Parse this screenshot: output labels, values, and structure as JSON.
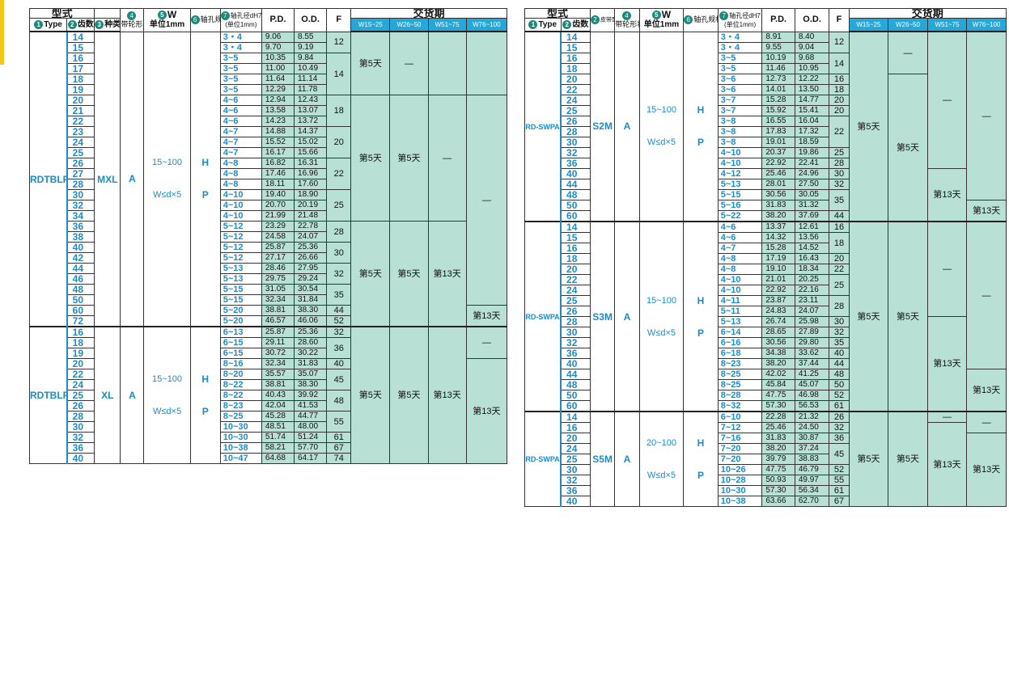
{
  "header": {
    "type_group": "型式",
    "type_label": "Type",
    "teeth_label": "齿数",
    "kind_label": "种类",
    "belt_shape": "带轮形状",
    "w_label": "W",
    "w_unit": "单位1mm",
    "shaft_spec": "轴孔规格",
    "bore_dia": "轴孔径dH7",
    "bore_unit": "(单位1mm)",
    "pd": "P.D.",
    "od": "O.D.",
    "f": "F",
    "delivery": "交货期",
    "w1": "W15~25",
    "w2": "W26~50",
    "w3": "W51~75",
    "w4": "W76~100",
    "n1": "1",
    "n2": "2",
    "n3": "3",
    "n4": "4",
    "n5": "5",
    "n6": "6",
    "n7": "7",
    "belt_type_short": "皮带型号"
  },
  "left": {
    "sections": [
      {
        "type": "RDTBLRZB",
        "kind": "MXL",
        "shape": "A",
        "w_range": "15~100",
        "w_cond": "W≤d×5",
        "h": "H",
        "p": "P",
        "rows": [
          [
            "14",
            "3・4",
            "9.06",
            "8.55"
          ],
          [
            "15",
            "3・4",
            "9.70",
            "9.19"
          ],
          [
            "16",
            "3~5",
            "10.35",
            "9.84"
          ],
          [
            "17",
            "3~5",
            "11.00",
            "10.49"
          ],
          [
            "18",
            "3~5",
            "11.64",
            "11.14"
          ],
          [
            "19",
            "3~5",
            "12.29",
            "11.78"
          ],
          [
            "20",
            "4~6",
            "12.94",
            "12.43"
          ],
          [
            "21",
            "4~6",
            "13.58",
            "13.07"
          ],
          [
            "22",
            "4~6",
            "14.23",
            "13.72"
          ],
          [
            "23",
            "4~7",
            "14.88",
            "14.37"
          ],
          [
            "24",
            "4~7",
            "15.52",
            "15.02"
          ],
          [
            "25",
            "4~7",
            "16.17",
            "15.66"
          ],
          [
            "26",
            "4~8",
            "16.82",
            "16.31"
          ],
          [
            "27",
            "4~8",
            "17.46",
            "16.96"
          ],
          [
            "28",
            "4~8",
            "18.11",
            "17.60"
          ],
          [
            "30",
            "4~10",
            "19.40",
            "18.90"
          ],
          [
            "32",
            "4~10",
            "20.70",
            "20.19"
          ],
          [
            "34",
            "4~10",
            "21.99",
            "21.48"
          ],
          [
            "36",
            "5~12",
            "23.29",
            "22.78"
          ],
          [
            "38",
            "5~12",
            "24.58",
            "24.07"
          ],
          [
            "40",
            "5~12",
            "25.87",
            "25.36"
          ],
          [
            "42",
            "5~12",
            "27.17",
            "26.66"
          ],
          [
            "44",
            "5~13",
            "28.46",
            "27.95"
          ],
          [
            "46",
            "5~13",
            "29.75",
            "29.24"
          ],
          [
            "48",
            "5~15",
            "31.05",
            "30.54"
          ],
          [
            "50",
            "5~15",
            "32.34",
            "31.84"
          ],
          [
            "60",
            "5~20",
            "38.81",
            "38.30"
          ],
          [
            "72",
            "5~20",
            "46.57",
            "46.06"
          ]
        ],
        "f": [
          [
            "12",
            2
          ],
          [
            "14",
            4
          ],
          [
            "18",
            3
          ],
          [
            "20",
            3
          ],
          [
            "22",
            3
          ],
          [
            "25",
            3
          ],
          [
            "28",
            2
          ],
          [
            "30",
            2
          ],
          [
            "32",
            2
          ],
          [
            "35",
            2
          ],
          [
            "44",
            1
          ],
          [
            "52",
            1
          ]
        ],
        "d1": [
          [
            "第5天",
            6
          ],
          [
            "第5天",
            12
          ],
          [
            "第5天",
            10
          ]
        ],
        "d2": [
          [
            "—",
            6
          ],
          [
            "第5天",
            12
          ],
          [
            "第5天",
            10
          ]
        ],
        "d3": [
          [
            "",
            6
          ],
          [
            "—",
            12
          ],
          [
            "第13天",
            10
          ]
        ],
        "d4": [
          [
            "",
            6
          ],
          [
            "—",
            20
          ],
          [
            "第13天",
            2
          ]
        ]
      },
      {
        "type": "RDTBLRZB",
        "kind": "XL",
        "shape": "A",
        "w_range": "15~100",
        "w_cond": "W≤d×5",
        "h": "H",
        "p": "P",
        "rows": [
          [
            "16",
            "6~13",
            "25.87",
            "25.36"
          ],
          [
            "18",
            "6~15",
            "29.11",
            "28.60"
          ],
          [
            "19",
            "6~15",
            "30.72",
            "30.22"
          ],
          [
            "20",
            "8~16",
            "32.34",
            "31.83"
          ],
          [
            "22",
            "8~20",
            "35.57",
            "35.07"
          ],
          [
            "24",
            "8~22",
            "38.81",
            "38.30"
          ],
          [
            "25",
            "8~22",
            "40.43",
            "39.92"
          ],
          [
            "26",
            "8~23",
            "42.04",
            "41.53"
          ],
          [
            "28",
            "8~25",
            "45.28",
            "44.77"
          ],
          [
            "30",
            "10~30",
            "48.51",
            "48.00"
          ],
          [
            "32",
            "10~30",
            "51.74",
            "51.24"
          ],
          [
            "36",
            "10~38",
            "58.21",
            "57.70"
          ],
          [
            "40",
            "10~47",
            "64.68",
            "64.17"
          ]
        ],
        "f": [
          [
            "32",
            1
          ],
          [
            "36",
            2
          ],
          [
            "40",
            1
          ],
          [
            "45",
            2
          ],
          [
            "48",
            2
          ],
          [
            "55",
            2
          ],
          [
            "61",
            1
          ],
          [
            "67",
            1
          ],
          [
            "74",
            1
          ]
        ],
        "d1": [
          [
            "第5天",
            13
          ]
        ],
        "d2": [
          [
            "第5天",
            13
          ]
        ],
        "d3": [
          [
            "第13天",
            13
          ]
        ],
        "d4": [
          [
            "—",
            3
          ],
          [
            "第13天",
            10
          ]
        ]
      }
    ]
  },
  "right": {
    "sections": [
      {
        "type": "RD-SWPA",
        "kind": "S2M",
        "shape": "A",
        "w_range": "15~100",
        "w_cond": "W≤d×5",
        "h": "H",
        "p": "P",
        "rows": [
          [
            "14",
            "3・4",
            "8.91",
            "8.40"
          ],
          [
            "15",
            "3・4",
            "9.55",
            "9.04"
          ],
          [
            "16",
            "3~5",
            "10.19",
            "9.68"
          ],
          [
            "18",
            "3~5",
            "11.46",
            "10.95"
          ],
          [
            "20",
            "3~6",
            "12.73",
            "12.22"
          ],
          [
            "22",
            "3~6",
            "14.01",
            "13.50"
          ],
          [
            "24",
            "3~7",
            "15.28",
            "14.77"
          ],
          [
            "25",
            "3~7",
            "15.92",
            "15.41"
          ],
          [
            "26",
            "3~8",
            "16.55",
            "16.04"
          ],
          [
            "28",
            "3~8",
            "17.83",
            "17.32"
          ],
          [
            "30",
            "3~8",
            "19.01",
            "18.59"
          ],
          [
            "32",
            "4~10",
            "20.37",
            "19.86"
          ],
          [
            "36",
            "4~10",
            "22.92",
            "22.41"
          ],
          [
            "40",
            "4~12",
            "25.46",
            "24.96"
          ],
          [
            "44",
            "5~13",
            "28.01",
            "27.50"
          ],
          [
            "48",
            "5~15",
            "30.56",
            "30.05"
          ],
          [
            "50",
            "5~16",
            "31.83",
            "31.32"
          ],
          [
            "60",
            "5~22",
            "38.20",
            "37.69"
          ]
        ],
        "f": [
          [
            "12",
            2
          ],
          [
            "14",
            2
          ],
          [
            "16",
            1
          ],
          [
            "18",
            1
          ],
          [
            "20",
            1
          ],
          [
            "20",
            1
          ],
          [
            "22",
            3
          ],
          [
            "25",
            1
          ],
          [
            "28",
            1
          ],
          [
            "30",
            1
          ],
          [
            "32",
            1
          ],
          [
            "35",
            2
          ],
          [
            "44",
            1
          ]
        ],
        "d1": [
          [
            "第5天",
            18
          ]
        ],
        "d2": [
          [
            "—",
            4
          ],
          [
            "第5天",
            14
          ]
        ],
        "d3": [
          [
            "—",
            13
          ],
          [
            "第13天",
            5
          ]
        ],
        "d4": [
          [
            "—",
            16
          ],
          [
            "第13天",
            2
          ]
        ]
      },
      {
        "type": "RD-SWPA",
        "kind": "S3M",
        "shape": "A",
        "w_range": "15~100",
        "w_cond": "W≤d×5",
        "h": "H",
        "p": "P",
        "rows": [
          [
            "14",
            "4~6",
            "13.37",
            "12.61"
          ],
          [
            "15",
            "4~6",
            "14.32",
            "13.56"
          ],
          [
            "16",
            "4~7",
            "15.28",
            "14.52"
          ],
          [
            "18",
            "4~8",
            "17.19",
            "16.43"
          ],
          [
            "20",
            "4~8",
            "19.10",
            "18.34"
          ],
          [
            "22",
            "4~10",
            "21.01",
            "20.25"
          ],
          [
            "24",
            "4~10",
            "22.92",
            "22.16"
          ],
          [
            "25",
            "4~11",
            "23.87",
            "23.11"
          ],
          [
            "26",
            "5~11",
            "24.83",
            "24.07"
          ],
          [
            "28",
            "5~13",
            "26.74",
            "25.98"
          ],
          [
            "30",
            "6~14",
            "28.65",
            "27.89"
          ],
          [
            "32",
            "6~16",
            "30.56",
            "29.80"
          ],
          [
            "36",
            "6~18",
            "34.38",
            "33.62"
          ],
          [
            "40",
            "8~23",
            "38.20",
            "37.44"
          ],
          [
            "44",
            "8~25",
            "42.02",
            "41.25"
          ],
          [
            "48",
            "8~25",
            "45.84",
            "45.07"
          ],
          [
            "50",
            "8~28",
            "47.75",
            "46.98"
          ],
          [
            "60",
            "8~32",
            "57.30",
            "56.53"
          ]
        ],
        "f": [
          [
            "16",
            1
          ],
          [
            "18",
            2
          ],
          [
            "20",
            1
          ],
          [
            "22",
            1
          ],
          [
            "25",
            2
          ],
          [
            "28",
            2
          ],
          [
            "30",
            1
          ],
          [
            "32",
            1
          ],
          [
            "35",
            1
          ],
          [
            "40",
            1
          ],
          [
            "44",
            1
          ],
          [
            "48",
            1
          ],
          [
            "50",
            1
          ],
          [
            "52",
            1
          ],
          [
            "61",
            1
          ]
        ],
        "d1": [
          [
            "第5天",
            18
          ]
        ],
        "d2": [
          [
            "第5天",
            18
          ]
        ],
        "d3": [
          [
            "—",
            9
          ],
          [
            "第13天",
            9
          ]
        ],
        "d4": [
          [
            "—",
            14
          ],
          [
            "第13天",
            4
          ]
        ]
      },
      {
        "type": "RD-SWPA",
        "kind": "S5M",
        "shape": "A",
        "w_range": "20~100",
        "w_cond": "W≤d×5",
        "h": "H",
        "p": "P",
        "rows": [
          [
            "14",
            "6~10",
            "22.28",
            "21.32"
          ],
          [
            "16",
            "7~12",
            "25.46",
            "24.50"
          ],
          [
            "20",
            "7~16",
            "31.83",
            "30.87"
          ],
          [
            "24",
            "7~20",
            "38.20",
            "37.24"
          ],
          [
            "25",
            "7~20",
            "39.79",
            "38.83"
          ],
          [
            "30",
            "10~26",
            "47.75",
            "46.79"
          ],
          [
            "32",
            "10~28",
            "50.93",
            "49.97"
          ],
          [
            "36",
            "10~30",
            "57.30",
            "56.34"
          ],
          [
            "40",
            "10~38",
            "63.66",
            "62.70"
          ]
        ],
        "f": [
          [
            "26",
            1
          ],
          [
            "32",
            1
          ],
          [
            "36",
            1
          ],
          [
            "45",
            2
          ],
          [
            "52",
            1
          ],
          [
            "55",
            1
          ],
          [
            "61",
            1
          ],
          [
            "67",
            1
          ]
        ],
        "d1": [
          [
            "第5天",
            9
          ]
        ],
        "d2": [
          [
            "第5天",
            9
          ]
        ],
        "d3": [
          [
            "—",
            1
          ],
          [
            "第13天",
            8
          ]
        ],
        "d4": [
          [
            "—",
            2
          ],
          [
            "第13天",
            7
          ]
        ]
      }
    ]
  }
}
